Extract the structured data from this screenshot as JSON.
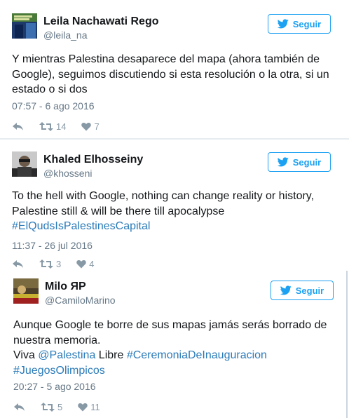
{
  "follow_label": "Seguir",
  "accent_color": "#1da1f2",
  "tweets": [
    {
      "name": "Leila Nachawati Rego",
      "handle": "@leila_na",
      "text_lines": [
        "Y mientras Palestina desaparece del mapa (ahora también de",
        "Google), seguimos discutiendo si esta resolución o la otra, si un",
        "estado o si dos"
      ],
      "timestamp": "07:57 - 6 ago 2016",
      "retweets": "14",
      "likes": "7",
      "avatar_icon": "avatar-image"
    },
    {
      "name": "Khaled Elhosseiny",
      "handle": "@khosseni",
      "text_lines": [
        "To the hell with Google, nothing can change reality or history,",
        "Palestine still & will be there till apocalypse"
      ],
      "hashtag": "#ElQudsIsPalestinesCapital",
      "timestamp": "11:37 - 26 jul 2016",
      "retweets": "3",
      "likes": "4",
      "avatar_icon": "avatar-image"
    },
    {
      "name": "Milo ЯP",
      "handle": "@CamiloMarino",
      "text_lines": [
        "Aunque Google te borre de sus mapas jamás serás borrado de",
        "nuestra memoria."
      ],
      "line3_prefix": "Viva ",
      "mention": "@Palestina",
      "line3_middle": " Libre ",
      "hashtag1": "#CeremoniaDeInauguracion",
      "hashtag2": "#JuegosOlimpicos",
      "timestamp": "20:27 - 5 ago 2016",
      "retweets": "5",
      "likes": "11",
      "avatar_icon": "avatar-image"
    }
  ]
}
